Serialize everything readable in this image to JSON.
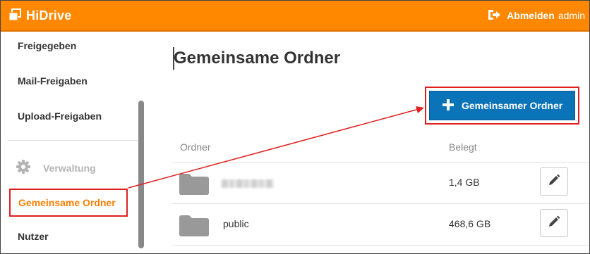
{
  "app": {
    "title": "HiDrive",
    "logout_label": "Abmelden",
    "user": "admin"
  },
  "sidebar": {
    "items": [
      {
        "label": "Freigegeben"
      },
      {
        "label": "Mail-Freigaben"
      },
      {
        "label": "Upload-Freigaben"
      }
    ],
    "section": {
      "label": "Verwaltung",
      "icon": "gear-icon"
    },
    "active_item": {
      "label": "Gemeinsame Ordner"
    },
    "bottom_item": {
      "label": "Nutzer"
    }
  },
  "main": {
    "title": "Gemeinsame Ordner",
    "add_button": {
      "label": "Gemeinsamer Ordner",
      "icon": "plus-icon"
    },
    "table": {
      "headers": {
        "folder": "Ordner",
        "used": "Belegt"
      },
      "rows": [
        {
          "name": "",
          "name_blurred": true,
          "size": "1,4 GB"
        },
        {
          "name": "public",
          "size": "468,6 GB"
        }
      ]
    }
  },
  "colors": {
    "header": "#ff8800",
    "active": "#ff7f00",
    "button": "#0b73b8",
    "highlight": "#e02020"
  }
}
